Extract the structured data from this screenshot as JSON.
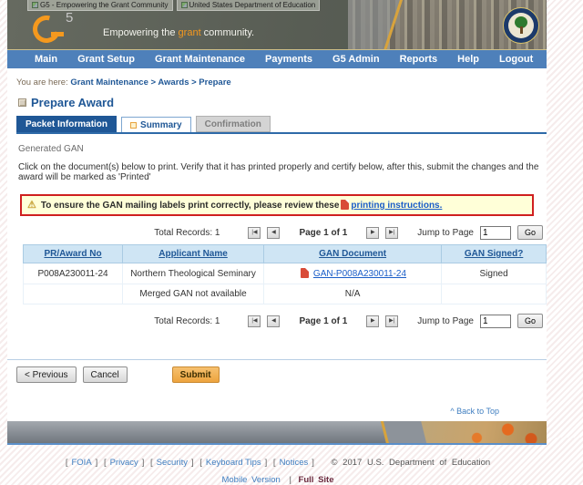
{
  "window": {
    "title_left": "G5 - Empowering the Grant Community",
    "title_right": "United States Department of Education"
  },
  "banner": {
    "logo_5": "5",
    "tagline_prefix": "Empowering the ",
    "tagline_highlight": "grant",
    "tagline_suffix": " community."
  },
  "nav": {
    "items": [
      {
        "label": "Main"
      },
      {
        "label": "Grant Setup"
      },
      {
        "label": "Grant Maintenance"
      },
      {
        "label": "Payments"
      },
      {
        "label": "G5 Admin"
      },
      {
        "label": "Reports"
      },
      {
        "label": "Help"
      },
      {
        "label": "Logout"
      }
    ]
  },
  "breadcrumb": {
    "prefix": "You are here: ",
    "path": "Grant Maintenance > Awards > Prepare"
  },
  "page": {
    "title": "Prepare Award",
    "tabs": [
      {
        "label": "Packet Information"
      },
      {
        "label": "Summary"
      },
      {
        "label": "Confirmation"
      }
    ],
    "section_label": "Generated GAN",
    "instructions": "Click on the document(s) below to print. Verify that it has printed properly and certify below, after this, submit the changes and the award will be marked as 'Printed'",
    "warning": {
      "icon": "⚠",
      "text": "To ensure the GAN mailing labels print correctly, please review these",
      "link": "printing instructions."
    }
  },
  "pagination": {
    "total_label": "Total Records:",
    "total_value": "1",
    "first": "|◀",
    "prev": "◀",
    "page_label": "Page 1 of 1",
    "next": "▶",
    "last": "▶|",
    "jump_label": "Jump to Page",
    "jump_value": "1",
    "go_label": "Go"
  },
  "table": {
    "headers": [
      "PR/Award No",
      "Applicant Name",
      "GAN Document",
      "GAN Signed?"
    ],
    "rows": [
      {
        "award_no": "P008A230011-24",
        "applicant": "Northern Theological Seminary",
        "gan_doc": "GAN-P008A230011-24",
        "signed": "Signed"
      },
      {
        "award_no": "",
        "applicant": "Merged GAN not available",
        "gan_doc": "N/A",
        "signed": ""
      }
    ]
  },
  "actions": {
    "previous": "< Previous",
    "cancel": "Cancel",
    "submit": "Submit"
  },
  "back_to_top": "^ Back to Top",
  "footer": {
    "bracket_open": "[",
    "bracket_close": "]",
    "links": [
      "FOIA",
      "Privacy",
      "Security",
      "Keyboard Tips",
      "Notices"
    ],
    "copyright": "© 2017 U.S. Department of Education",
    "mobile_version": "Mobile Version",
    "separator": "|",
    "full_site": "Full Site"
  },
  "colors": {
    "nav_blue": "#4e80ba",
    "tab_active_blue": "#1f5796",
    "link_blue": "#1a5dc8",
    "warning_bg": "#ffffd8",
    "warning_border": "#cf1f1f",
    "submit_orange": "#eda43e",
    "logo_orange": "#f5991e",
    "table_header_bg": "#cfe5f4"
  }
}
